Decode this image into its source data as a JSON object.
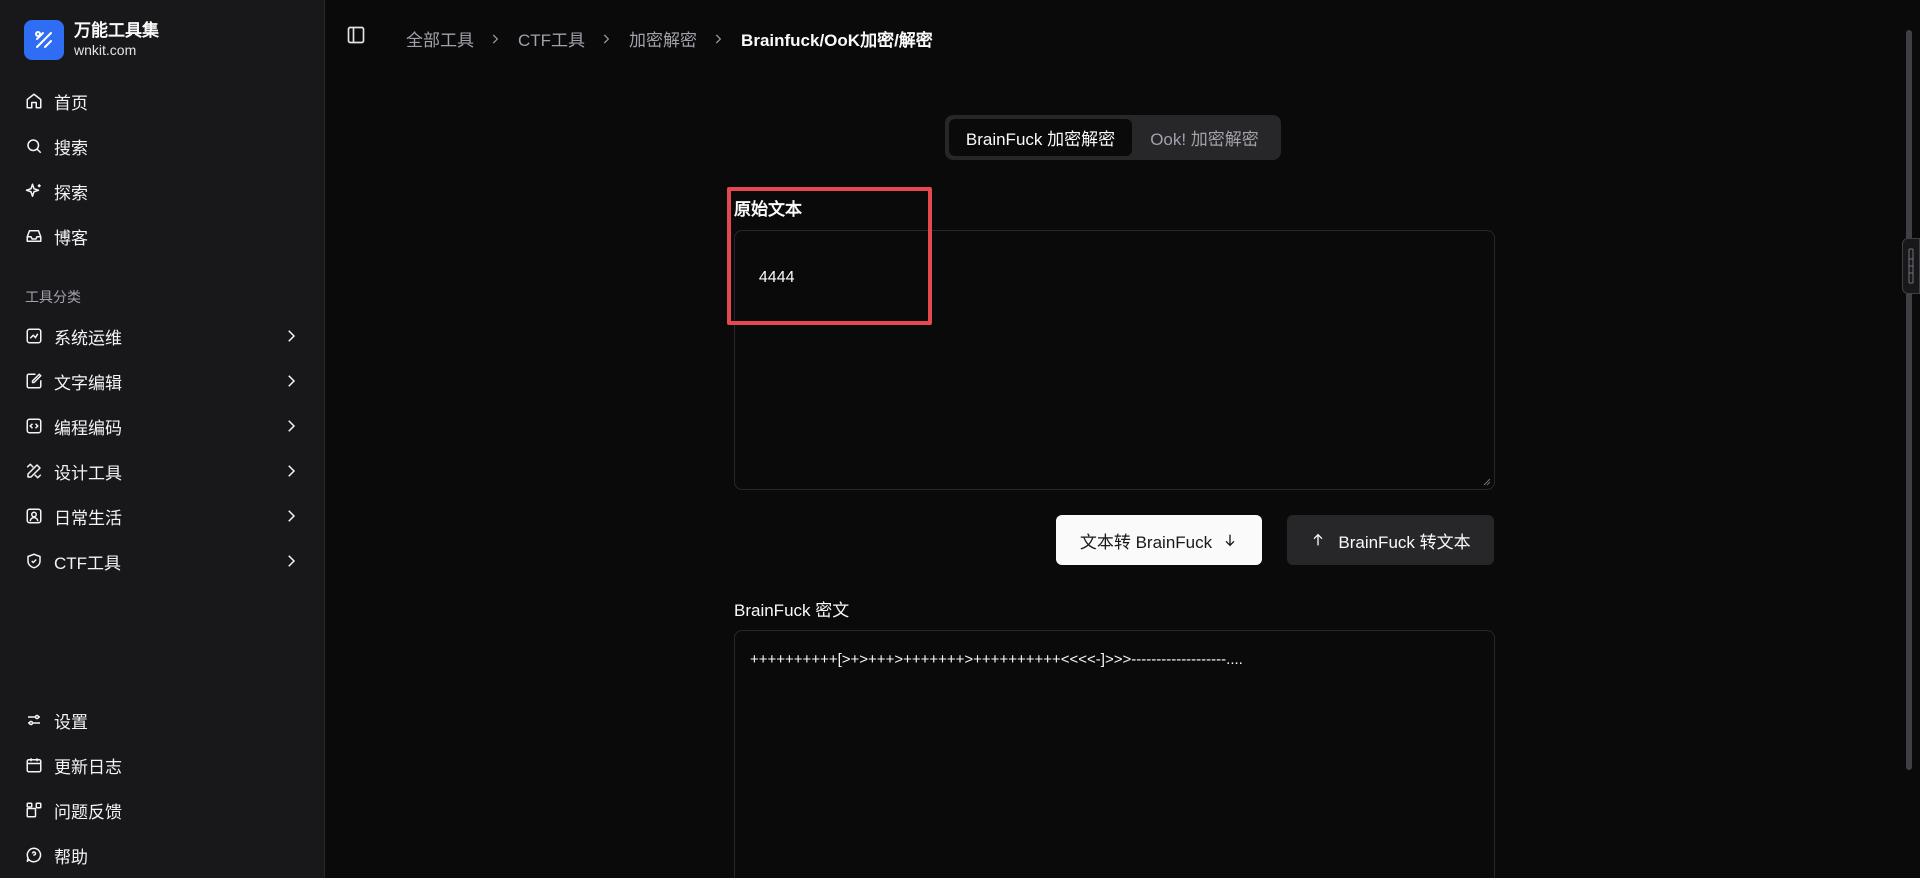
{
  "brand": {
    "name": "万能工具集",
    "domain": "wnkit.com",
    "accent": "#2f6df5"
  },
  "sidebar": {
    "top_items": [
      {
        "label": "首页",
        "icon": "home-icon"
      },
      {
        "label": "搜索",
        "icon": "search-icon"
      },
      {
        "label": "探索",
        "icon": "sparkles-icon"
      },
      {
        "label": "博客",
        "icon": "inbox-icon"
      }
    ],
    "section_label": "工具分类",
    "categories": [
      {
        "label": "系统运维",
        "icon": "server-icon"
      },
      {
        "label": "文字编辑",
        "icon": "edit-icon"
      },
      {
        "label": "编程编码",
        "icon": "code-icon"
      },
      {
        "label": "设计工具",
        "icon": "design-icon"
      },
      {
        "label": "日常生活",
        "icon": "user-square-icon"
      },
      {
        "label": "CTF工具",
        "icon": "shield-icon"
      }
    ],
    "bottom_items": [
      {
        "label": "设置",
        "icon": "settings-icon"
      },
      {
        "label": "更新日志",
        "icon": "calendar-icon"
      },
      {
        "label": "问题反馈",
        "icon": "feedback-icon"
      },
      {
        "label": "帮助",
        "icon": "help-icon"
      }
    ]
  },
  "breadcrumb": {
    "items": [
      "全部工具",
      "CTF工具",
      "加密解密"
    ],
    "current": "Brainfuck/OoK加密/解密"
  },
  "tabs": {
    "active": "BrainFuck 加密解密",
    "inactive": "Ook! 加密解密"
  },
  "input": {
    "label": "原始文本",
    "value": "4444"
  },
  "buttons": {
    "encode": "文本转 BrainFuck",
    "decode": "BrainFuck 转文本"
  },
  "output": {
    "label": "BrainFuck 密文",
    "value": "++++++++++[>+>+++>+++++++>++++++++++<<<<-]>>>-------------------...."
  },
  "colors": {
    "highlight": "#e5484d"
  }
}
